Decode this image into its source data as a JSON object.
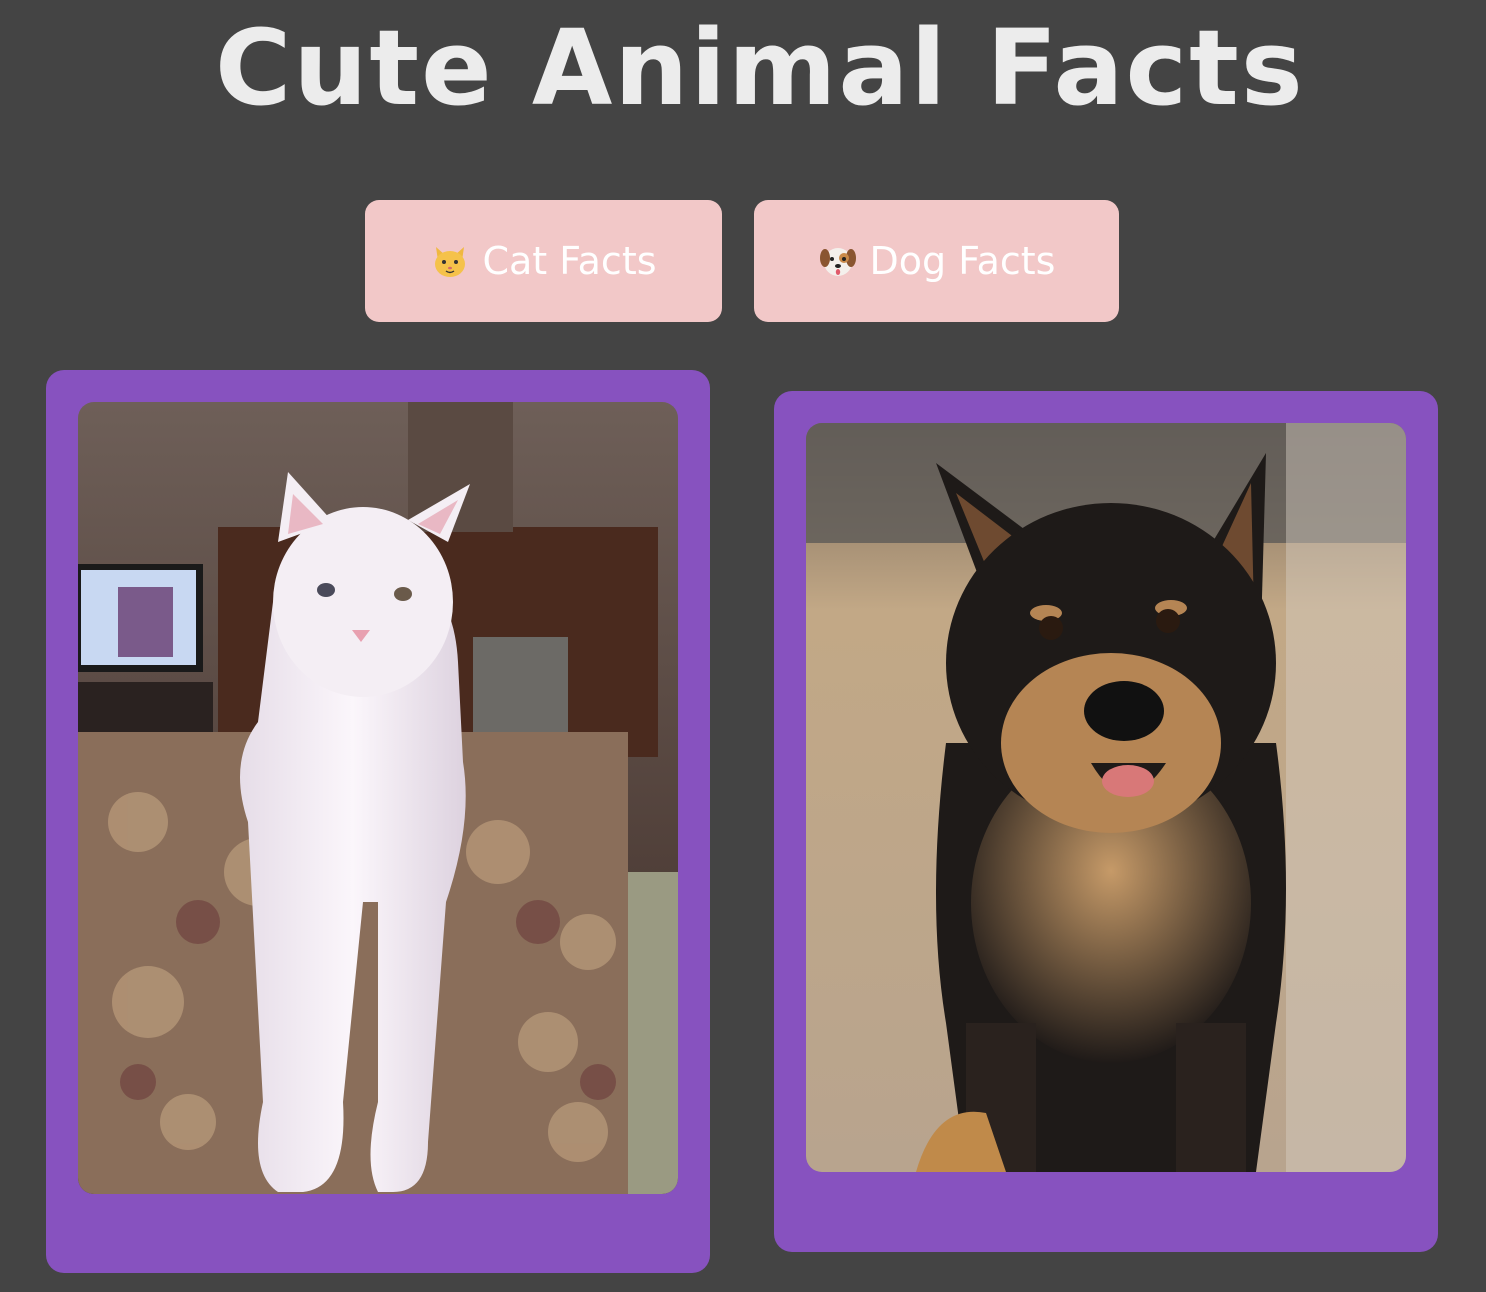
{
  "page": {
    "title": "Cute Animal Facts",
    "background": "#444444"
  },
  "buttons": [
    {
      "label": "Cat Facts",
      "icon": "cat-face-icon"
    },
    {
      "label": "Dog Facts",
      "icon": "dog-face-icon"
    }
  ],
  "cards": [
    {
      "subject": "white-cat-photo",
      "color": "#8752bf"
    },
    {
      "subject": "black-tan-dog-photo",
      "color": "#8752bf"
    }
  ],
  "colors": {
    "button": "#f2c8c8",
    "card": "#8752bf",
    "title": "#ececec"
  }
}
